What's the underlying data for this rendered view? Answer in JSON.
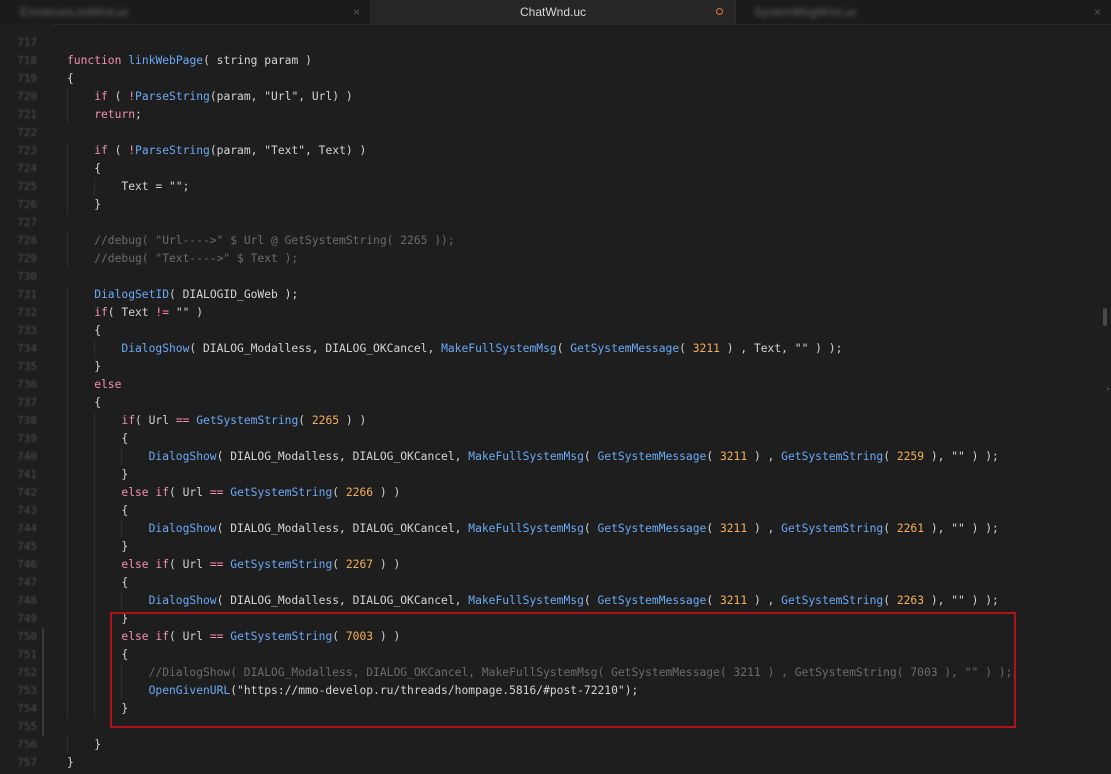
{
  "tabs": [
    {
      "label": "EmoticonListWnd.uc",
      "active": false,
      "close": "×"
    },
    {
      "label": "ChatWnd.uc",
      "active": true,
      "modified": true
    },
    {
      "label": "SystemMsgWnd.uc",
      "active": false,
      "close": "×"
    }
  ],
  "colors": {
    "background": "#1e1e1e",
    "keyword": "#f48fb1",
    "function": "#6aa9f5",
    "number": "#f3b05a",
    "comment": "#6c6c6c",
    "highlight_border": "#b3121d"
  },
  "lines": [
    {
      "n": "717",
      "indent": 0,
      "tokens": []
    },
    {
      "n": "718",
      "indent": 0,
      "tokens": [
        [
          "kw",
          "function"
        ],
        [
          "t",
          " "
        ],
        [
          "fn",
          "linkWebPage"
        ],
        [
          "t",
          "( string param )"
        ]
      ]
    },
    {
      "n": "719",
      "indent": 0,
      "tokens": [
        [
          "t",
          "{"
        ]
      ]
    },
    {
      "n": "720",
      "indent": 1,
      "tokens": [
        [
          "kw",
          "if"
        ],
        [
          "t",
          " ( "
        ],
        [
          "op",
          "!"
        ],
        [
          "fn",
          "ParseString"
        ],
        [
          "t",
          "(param, \"Url\", Url) )"
        ]
      ]
    },
    {
      "n": "721",
      "indent": 1,
      "tokens": [
        [
          "kw",
          "return"
        ],
        [
          "t",
          ";"
        ]
      ]
    },
    {
      "n": "722",
      "indent": 0,
      "tokens": []
    },
    {
      "n": "723",
      "indent": 1,
      "tokens": [
        [
          "kw",
          "if"
        ],
        [
          "t",
          " ( "
        ],
        [
          "op",
          "!"
        ],
        [
          "fn",
          "ParseString"
        ],
        [
          "t",
          "(param, \"Text\", Text) )"
        ]
      ]
    },
    {
      "n": "724",
      "indent": 1,
      "tokens": [
        [
          "t",
          "{"
        ]
      ]
    },
    {
      "n": "725",
      "indent": 2,
      "tokens": [
        [
          "t",
          "Text = \"\";"
        ]
      ]
    },
    {
      "n": "726",
      "indent": 1,
      "tokens": [
        [
          "t",
          "}"
        ]
      ]
    },
    {
      "n": "727",
      "indent": 0,
      "tokens": []
    },
    {
      "n": "728",
      "indent": 1,
      "tokens": [
        [
          "cm",
          "//debug( \"Url---->\" $ Url @ GetSystemString( 2265 ));"
        ]
      ]
    },
    {
      "n": "729",
      "indent": 1,
      "tokens": [
        [
          "cm",
          "//debug( \"Text---->\" $ Text );"
        ]
      ]
    },
    {
      "n": "730",
      "indent": 0,
      "tokens": []
    },
    {
      "n": "731",
      "indent": 1,
      "tokens": [
        [
          "fn",
          "DialogSetID"
        ],
        [
          "t",
          "( DIALOGID_GoWeb );"
        ]
      ]
    },
    {
      "n": "732",
      "indent": 1,
      "tokens": [
        [
          "kw",
          "if"
        ],
        [
          "t",
          "( Text "
        ],
        [
          "op",
          "!="
        ],
        [
          "t",
          " \"\" )"
        ]
      ]
    },
    {
      "n": "733",
      "indent": 1,
      "tokens": [
        [
          "t",
          "{"
        ]
      ]
    },
    {
      "n": "734",
      "indent": 2,
      "tokens": [
        [
          "fn",
          "DialogShow"
        ],
        [
          "t",
          "( DIALOG_Modalless, DIALOG_OKCancel, "
        ],
        [
          "fn",
          "MakeFullSystemMsg"
        ],
        [
          "t",
          "( "
        ],
        [
          "fn",
          "GetSystemMessage"
        ],
        [
          "t",
          "( "
        ],
        [
          "num",
          "3211"
        ],
        [
          "t",
          " ) , Text, \"\" ) );"
        ]
      ]
    },
    {
      "n": "735",
      "indent": 1,
      "tokens": [
        [
          "t",
          "}"
        ]
      ]
    },
    {
      "n": "736",
      "indent": 1,
      "tokens": [
        [
          "kw",
          "else"
        ]
      ]
    },
    {
      "n": "737",
      "indent": 1,
      "tokens": [
        [
          "t",
          "{"
        ]
      ]
    },
    {
      "n": "738",
      "indent": 2,
      "tokens": [
        [
          "kw",
          "if"
        ],
        [
          "t",
          "( Url "
        ],
        [
          "op",
          "=="
        ],
        [
          "t",
          " "
        ],
        [
          "fn",
          "GetSystemString"
        ],
        [
          "t",
          "( "
        ],
        [
          "num",
          "2265"
        ],
        [
          "t",
          " ) )"
        ]
      ]
    },
    {
      "n": "739",
      "indent": 2,
      "tokens": [
        [
          "t",
          "{"
        ]
      ]
    },
    {
      "n": "740",
      "indent": 3,
      "tokens": [
        [
          "fn",
          "DialogShow"
        ],
        [
          "t",
          "( DIALOG_Modalless, DIALOG_OKCancel, "
        ],
        [
          "fn",
          "MakeFullSystemMsg"
        ],
        [
          "t",
          "( "
        ],
        [
          "fn",
          "GetSystemMessage"
        ],
        [
          "t",
          "( "
        ],
        [
          "num",
          "3211"
        ],
        [
          "t",
          " ) , "
        ],
        [
          "fn",
          "GetSystemString"
        ],
        [
          "t",
          "( "
        ],
        [
          "num",
          "2259"
        ],
        [
          "t",
          " ), \"\" ) );"
        ]
      ]
    },
    {
      "n": "741",
      "indent": 2,
      "tokens": [
        [
          "t",
          "}"
        ]
      ]
    },
    {
      "n": "742",
      "indent": 2,
      "tokens": [
        [
          "kw",
          "else if"
        ],
        [
          "t",
          "( Url "
        ],
        [
          "op",
          "=="
        ],
        [
          "t",
          " "
        ],
        [
          "fn",
          "GetSystemString"
        ],
        [
          "t",
          "( "
        ],
        [
          "num",
          "2266"
        ],
        [
          "t",
          " ) )"
        ]
      ]
    },
    {
      "n": "743",
      "indent": 2,
      "tokens": [
        [
          "t",
          "{"
        ]
      ]
    },
    {
      "n": "744",
      "indent": 3,
      "tokens": [
        [
          "fn",
          "DialogShow"
        ],
        [
          "t",
          "( DIALOG_Modalless, DIALOG_OKCancel, "
        ],
        [
          "fn",
          "MakeFullSystemMsg"
        ],
        [
          "t",
          "( "
        ],
        [
          "fn",
          "GetSystemMessage"
        ],
        [
          "t",
          "( "
        ],
        [
          "num",
          "3211"
        ],
        [
          "t",
          " ) , "
        ],
        [
          "fn",
          "GetSystemString"
        ],
        [
          "t",
          "( "
        ],
        [
          "num",
          "2261"
        ],
        [
          "t",
          " ), \"\" ) );"
        ]
      ]
    },
    {
      "n": "745",
      "indent": 2,
      "tokens": [
        [
          "t",
          "}"
        ]
      ]
    },
    {
      "n": "746",
      "indent": 2,
      "tokens": [
        [
          "kw",
          "else if"
        ],
        [
          "t",
          "( Url "
        ],
        [
          "op",
          "=="
        ],
        [
          "t",
          " "
        ],
        [
          "fn",
          "GetSystemString"
        ],
        [
          "t",
          "( "
        ],
        [
          "num",
          "2267"
        ],
        [
          "t",
          " ) )"
        ]
      ]
    },
    {
      "n": "747",
      "indent": 2,
      "tokens": [
        [
          "t",
          "{"
        ]
      ]
    },
    {
      "n": "748",
      "indent": 3,
      "tokens": [
        [
          "fn",
          "DialogShow"
        ],
        [
          "t",
          "( DIALOG_Modalless, DIALOG_OKCancel, "
        ],
        [
          "fn",
          "MakeFullSystemMsg"
        ],
        [
          "t",
          "( "
        ],
        [
          "fn",
          "GetSystemMessage"
        ],
        [
          "t",
          "( "
        ],
        [
          "num",
          "3211"
        ],
        [
          "t",
          " ) , "
        ],
        [
          "fn",
          "GetSystemString"
        ],
        [
          "t",
          "( "
        ],
        [
          "num",
          "2263"
        ],
        [
          "t",
          " ), \"\" ) );"
        ]
      ]
    },
    {
      "n": "749",
      "indent": 2,
      "tokens": [
        [
          "t",
          "}"
        ]
      ]
    },
    {
      "n": "750",
      "indent": 2,
      "mod": true,
      "tokens": [
        [
          "kw",
          "else if"
        ],
        [
          "t",
          "( Url "
        ],
        [
          "op",
          "=="
        ],
        [
          "t",
          " "
        ],
        [
          "fn",
          "GetSystemString"
        ],
        [
          "t",
          "( "
        ],
        [
          "num",
          "7003"
        ],
        [
          "t",
          " ) )"
        ]
      ]
    },
    {
      "n": "751",
      "indent": 2,
      "mod": true,
      "tokens": [
        [
          "t",
          "{"
        ]
      ]
    },
    {
      "n": "752",
      "indent": 3,
      "mod": true,
      "tokens": [
        [
          "cm",
          "//DialogShow( DIALOG_Modalless, DIALOG_OKCancel, MakeFullSystemMsg( GetSystemMessage( 3211 ) , GetSystemString( 7003 ), \"\" ) );"
        ]
      ]
    },
    {
      "n": "753",
      "indent": 3,
      "mod": true,
      "tokens": [
        [
          "fn",
          "OpenGivenURL"
        ],
        [
          "t",
          "(\"https://mmo-develop.ru/threads/hompage.5816/#post-72210\");"
        ]
      ]
    },
    {
      "n": "754",
      "indent": 2,
      "mod": true,
      "tokens": [
        [
          "t",
          "}"
        ]
      ]
    },
    {
      "n": "755",
      "indent": 0,
      "mod": true,
      "tokens": []
    },
    {
      "n": "756",
      "indent": 1,
      "tokens": [
        [
          "t",
          "}"
        ]
      ]
    },
    {
      "n": "757",
      "indent": 0,
      "tokens": [
        [
          "t",
          "}"
        ]
      ]
    }
  ]
}
